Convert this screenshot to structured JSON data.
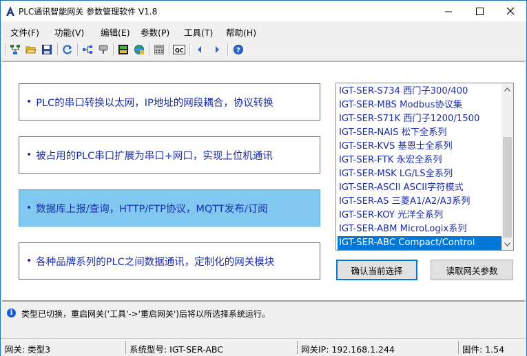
{
  "window": {
    "title": "PLC通讯智能网关 参数管理软件 V1.8",
    "minimize": "—",
    "maximize": "☐",
    "close": "✕"
  },
  "menu": [
    "文件(F)",
    "功能(V)",
    "编辑(E)",
    "参数(P)",
    "工具(T)",
    "帮助(H)"
  ],
  "toolbar_icons": [
    "network-icon",
    "open-folder-icon",
    "save-icon",
    "refresh-icon",
    "topology-icon",
    "probe-icon",
    "monitor-icon",
    "web-icon",
    "calculator-icon",
    "qc-icon",
    "back-icon",
    "forward-icon",
    "help-icon"
  ],
  "features": [
    {
      "bullet": "•",
      "text": "PLC的串口转换以太网，IP地址的网段耦合，协议转换"
    },
    {
      "bullet": "•",
      "text": "被占用的PLC串口扩展为串口+网口，实现上位机通讯"
    },
    {
      "bullet": "•",
      "text": "数据库上报/查询，HTTP/FTP协议，MQTT发布/订阅"
    },
    {
      "bullet": "•",
      "text": "各种品牌系列的PLC之间数据通讯，定制化的网关模块"
    }
  ],
  "selected_feature": 2,
  "gateway_list": [
    "IGT-SER-S734  西门子300/400",
    "IGT-SER-MBS  Modbus协议集",
    "IGT-SER-S71K  西门子1200/1500",
    "IGT-SER-NAIS  松下全系列",
    "IGT-SER-KVS  基恩士全系列",
    "IGT-SER-FTK  永宏全系列",
    "IGT-SER-MSK  LG/LS全系列",
    "IGT-SER-ASCII  ASCII字符模式",
    "IGT-SER-AS  三菱A1/A2/A3系列",
    "IGT-SER-KOY  光洋全系列",
    "IGT-SER-ABM  MicroLogix系列",
    "IGT-SER-ABC  Compact/Control"
  ],
  "selected_gateway": 11,
  "buttons": {
    "confirm": "确认当前选择",
    "read_params": "读取网关参数"
  },
  "message": "类型已切换，重启网关('工具'->'重启网关')后将以所选择系统运行。",
  "status": {
    "gateway": "网关:  类型3",
    "system_model": "系统型号:  IGT-SER-ABC",
    "gateway_ip": "网关IP:  192.168.1.244",
    "firmware": "固件:  1.54"
  },
  "colors": {
    "accent": "#0078d7",
    "feature_text": "#1b2dac",
    "selected_feature_bg": "#80c8ef"
  }
}
